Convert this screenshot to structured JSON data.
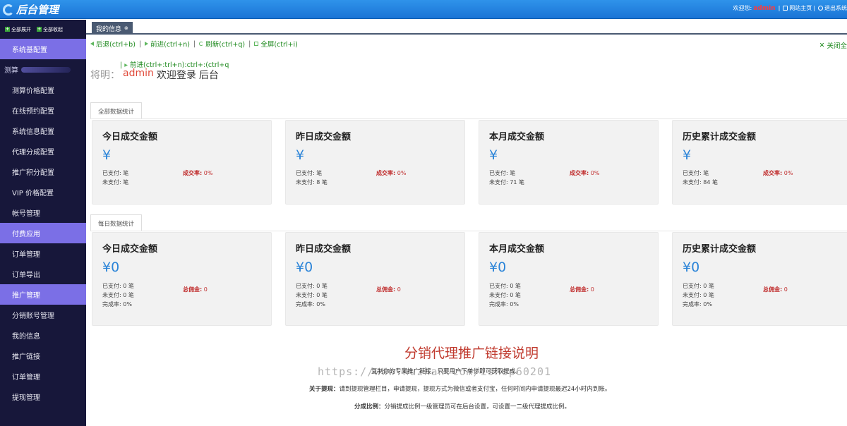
{
  "header": {
    "logo_text": "后台管理",
    "welcome": "欢迎您",
    "user": "admin",
    "site_home": "网站主页",
    "exit": "退出系统"
  },
  "sidebar": {
    "expand_all": "全部展开",
    "collapse_all": "全部收起",
    "items": [
      {
        "label": "系统基配置",
        "type": "header"
      },
      {
        "label": "测算",
        "type": "blur"
      },
      {
        "label": "测算价格配置",
        "type": "item"
      },
      {
        "label": "在线预约配置",
        "type": "item"
      },
      {
        "label": "系统信息配置",
        "type": "item"
      },
      {
        "label": "代理分成配置",
        "type": "item"
      },
      {
        "label": "推广积分配置",
        "type": "item"
      },
      {
        "label": "VIP 价格配置",
        "type": "item"
      },
      {
        "label": "帐号管理",
        "type": "item"
      },
      {
        "label": "付费应用",
        "type": "header"
      },
      {
        "label": "订单管理",
        "type": "item"
      },
      {
        "label": "订单导出",
        "type": "item"
      },
      {
        "label": "推广管理",
        "type": "header"
      },
      {
        "label": "分销账号管理",
        "type": "item"
      },
      {
        "label": "我的信息",
        "type": "item"
      },
      {
        "label": "推广链接",
        "type": "item"
      },
      {
        "label": "订单管理",
        "type": "item"
      },
      {
        "label": "提现管理",
        "type": "item"
      }
    ]
  },
  "tabs": {
    "active": "我的信息",
    "close": "⊗"
  },
  "navbar": {
    "back": "后退(ctrl+b)",
    "forward": "前进(ctrl+n)",
    "refresh": "刷新(ctrl+q)",
    "fullscreen": "全屏(ctrl+i)",
    "close_all": "关闭全",
    "overlay": "前进(ctrl+:trl+n):ctrl+:(ctrl+q"
  },
  "welcome": {
    "ghost": "将明：",
    "name": "admin",
    "text": "欢迎登录",
    "suffix": "后台"
  },
  "sections": {
    "all": "全部数据统计",
    "daily": "每日数据统计"
  },
  "all_cards": [
    {
      "title": "今日成交金额",
      "money": "¥",
      "paid": "已支付: 笔",
      "unpaid": "未支付: 笔",
      "rate_label": "成交率:",
      "rate": "0%"
    },
    {
      "title": "昨日成交金额",
      "money": "¥",
      "paid": "已支付: 笔",
      "unpaid": "未支付: 8 笔",
      "rate_label": "成交率:",
      "rate": "0%"
    },
    {
      "title": "本月成交金额",
      "money": "¥",
      "paid": "已支付: 笔",
      "unpaid": "未支付: 71 笔",
      "rate_label": "成交率:",
      "rate": "0%"
    },
    {
      "title": "历史累计成交金额",
      "money": "¥",
      "paid": "已支付: 笔",
      "unpaid": "未支付: 84 笔",
      "rate_label": "成交率:",
      "rate": "0%"
    }
  ],
  "daily_cards": [
    {
      "title": "今日成交金额",
      "money": "¥0",
      "paid": "已支付: 0 笔",
      "unpaid": "未支付: 0 笔",
      "done": "完成率: 0%",
      "comm_label": "总佣金:",
      "comm": "0"
    },
    {
      "title": "昨日成交金额",
      "money": "¥0",
      "paid": "已支付: 0 笔",
      "unpaid": "未支付: 0 笔",
      "done": "完成率: 0%",
      "comm_label": "总佣金:",
      "comm": "0"
    },
    {
      "title": "本月成交金额",
      "money": "¥0",
      "paid": "已支付: 0 笔",
      "unpaid": "未支付: 0 笔",
      "done": "完成率: 0%",
      "comm_label": "总佣金:",
      "comm": "0"
    },
    {
      "title": "历史累计成交金额",
      "money": "¥0",
      "paid": "已支付: 0 笔",
      "unpaid": "未支付: 0 笔",
      "done": "完成率: 0%",
      "comm_label": "总佣金:",
      "comm": "0"
    }
  ],
  "explain": {
    "title": "分销代理推广链接说明",
    "line1": "复制你的专属推广链接，只要用户下单你即可获取提成。",
    "line2_label": "关于提现：",
    "line2": "请到提现管理栏目，申请提现，提现方式为微信或者支付宝，任何时间内申请提现最迟24小时内到账。",
    "line3_label": "分成比例：",
    "line3": "分销提成比例一级管理员可在后台设置，可设置一二级代理提成比例。",
    "watermark": "https://www.huzhan.com/ishop60201"
  }
}
